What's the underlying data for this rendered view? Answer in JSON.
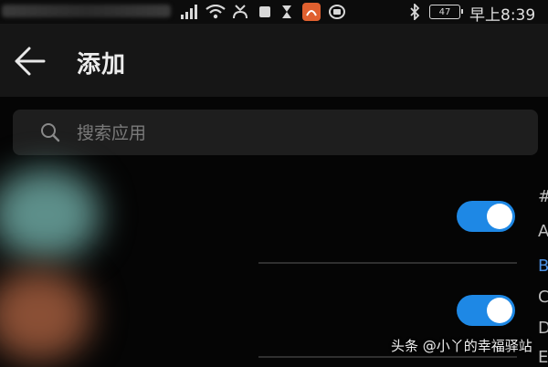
{
  "status_bar": {
    "battery_level": "47",
    "clock": "早上8:39",
    "icons": [
      "signal-icon",
      "wifi-icon",
      "missed-call-icon",
      "notification-icon",
      "hourglass-icon",
      "app-notification-icon",
      "sync-icon",
      "bluetooth-icon"
    ]
  },
  "header": {
    "back_icon": "back-arrow-icon",
    "title": "添加"
  },
  "search": {
    "placeholder": "搜索应用",
    "value": ""
  },
  "app_list": {
    "items": [
      {
        "toggle_on": true,
        "icon_color": "#5d8f8a"
      },
      {
        "toggle_on": true,
        "icon_color": "#8a4f35"
      }
    ],
    "toggle_color": "#1e88e5"
  },
  "index_sidebar": {
    "letters": [
      "#",
      "A",
      "B",
      "C",
      "D",
      "E"
    ],
    "active": "B",
    "active_color": "#4a90e2"
  },
  "watermark": {
    "text": "头条 @小丫的幸福驿站"
  }
}
